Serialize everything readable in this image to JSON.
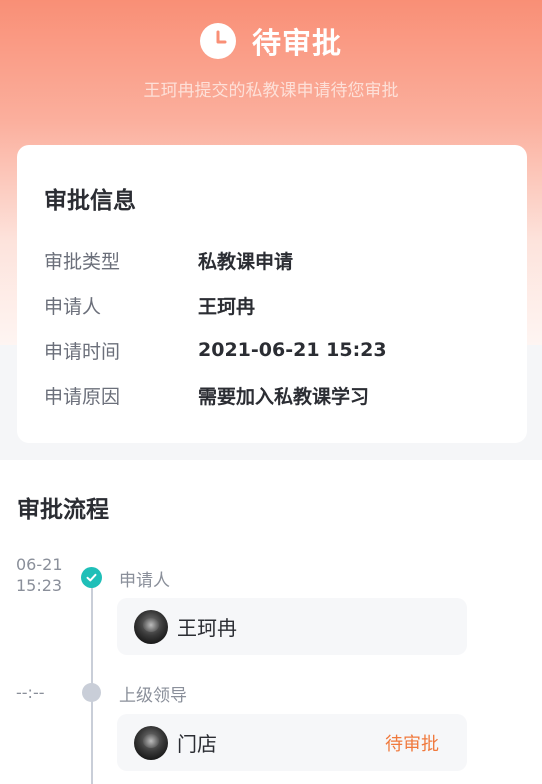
{
  "header": {
    "status_title": "待审批",
    "subtitle": "王珂冉提交的私教课申请待您审批"
  },
  "info_card": {
    "title": "审批信息",
    "rows": [
      {
        "label": "审批类型",
        "value": "私教课申请"
      },
      {
        "label": "申请人",
        "value": "王珂冉"
      },
      {
        "label": "申请时间",
        "value": "2021-06-21 15:23"
      },
      {
        "label": "申请原因",
        "value": "需要加入私教课学习"
      }
    ]
  },
  "process": {
    "title": "审批流程",
    "steps": [
      {
        "date": "06-21",
        "time": "15:23",
        "label": "申请人",
        "name": "王珂冉",
        "status": "",
        "done": true
      },
      {
        "date": "--:--",
        "time": "",
        "label": "上级领导",
        "name": "门店",
        "status": "待审批",
        "done": false
      }
    ]
  },
  "colors": {
    "header_gradient_top": "#f98f76",
    "done_dot": "#1fbfb8",
    "pending_dot": "#c9ced8",
    "pending_status": "#f07a3e"
  },
  "icons": {
    "status_icon": "clock-icon",
    "done_icon": "check-icon"
  }
}
